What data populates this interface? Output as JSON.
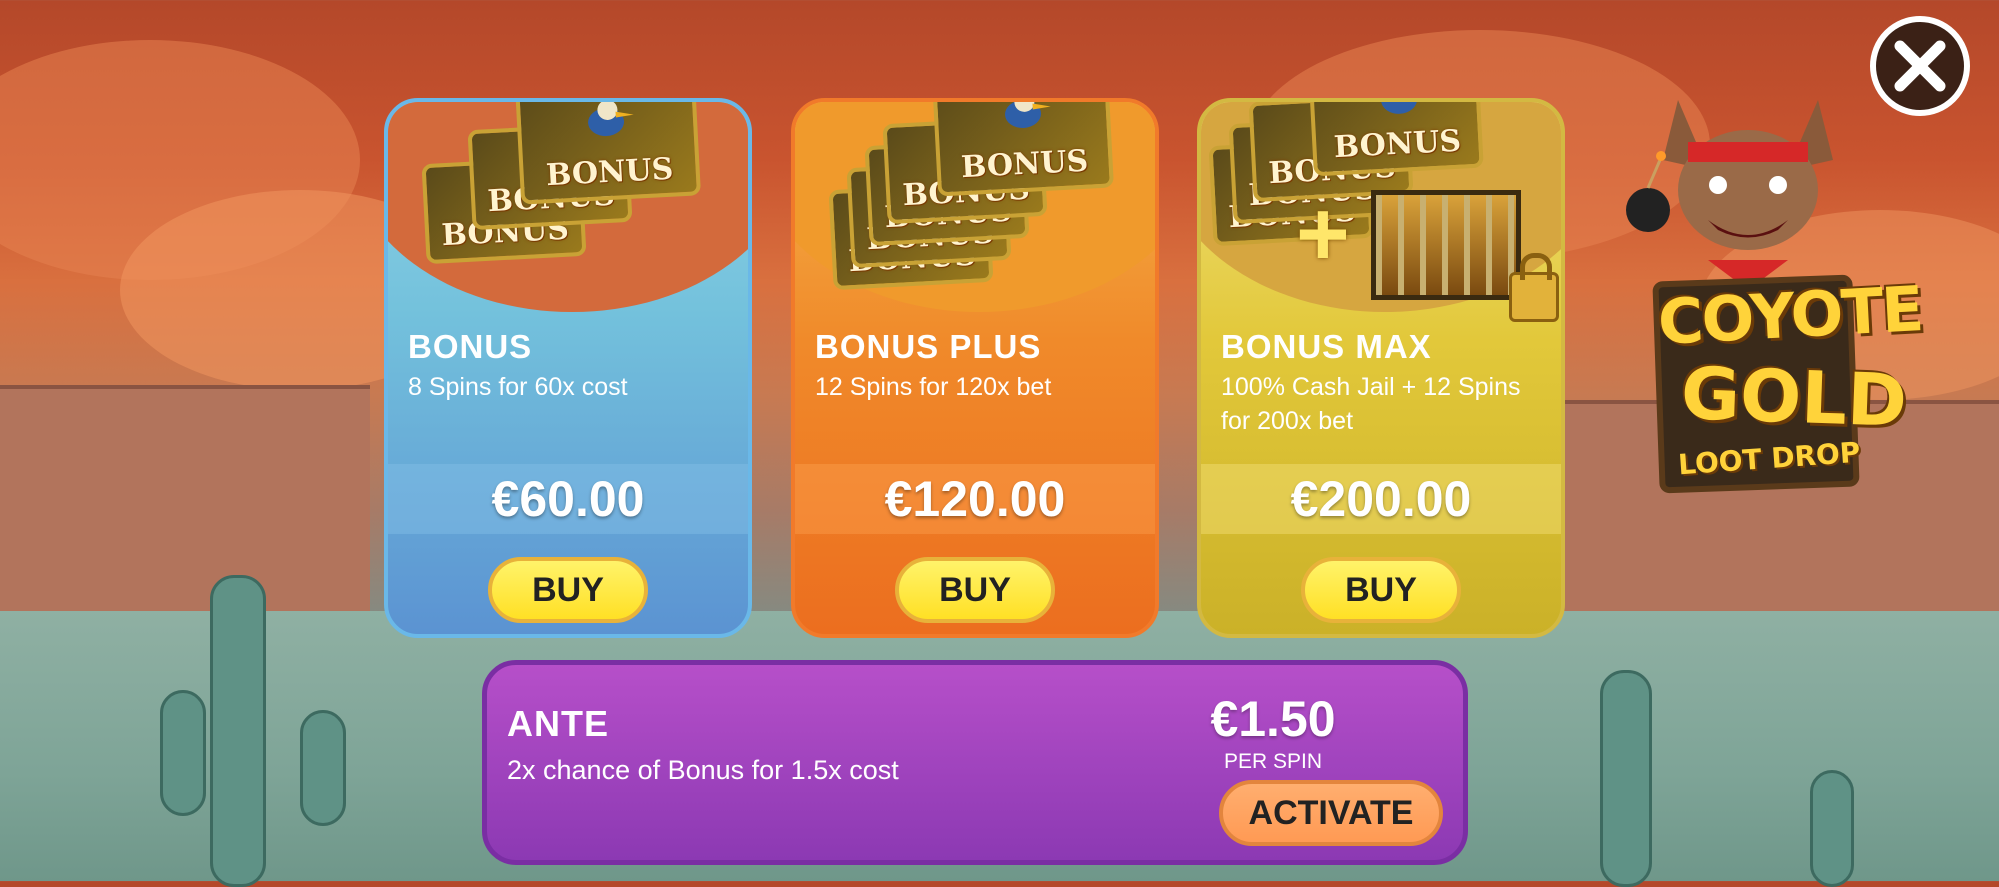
{
  "close_button": {
    "icon": "close-icon"
  },
  "logo": {
    "line1": "COYOTE",
    "line2": "GOLD",
    "line3": "LOOT DROP"
  },
  "cards": [
    {
      "title": "BONUS",
      "description": "8 Spins for 60x cost",
      "price": "€60.00",
      "button_label": "BUY",
      "tile_label": "BONUS",
      "color": "#5b93d2"
    },
    {
      "title": "BONUS PLUS",
      "description": "12 Spins for 120x bet",
      "price": "€120.00",
      "button_label": "BUY",
      "tile_label": "BONUS",
      "color": "#ec6e1f"
    },
    {
      "title": "BONUS MAX",
      "description": "100% Cash Jail + 12 Spins for 200x bet",
      "price": "€200.00",
      "button_label": "BUY",
      "tile_label": "BONUS",
      "color": "#cbb128"
    }
  ],
  "ante": {
    "title": "ANTE",
    "description": "2x chance of Bonus for 1.5x cost",
    "price": "€1.50",
    "per_label": "PER SPIN",
    "button_label": "ACTIVATE",
    "color": "#8c39b3"
  }
}
